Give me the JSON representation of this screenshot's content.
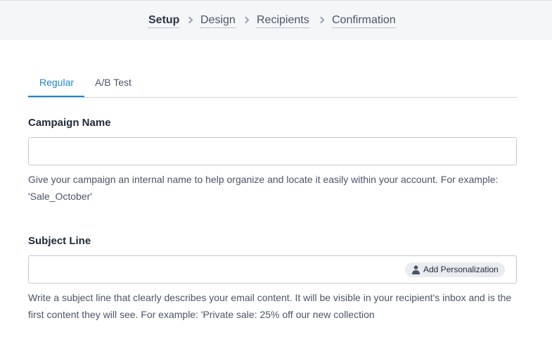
{
  "steps": [
    {
      "label": "Setup",
      "active": true
    },
    {
      "label": "Design",
      "active": false
    },
    {
      "label": "Recipients",
      "active": false
    },
    {
      "label": "Confirmation",
      "active": false
    }
  ],
  "tabs": [
    {
      "label": "Regular",
      "active": true
    },
    {
      "label": "A/B Test",
      "active": false
    }
  ],
  "campaign": {
    "label": "Campaign Name",
    "value": "",
    "help": "Give your campaign an internal name to help organize and locate it easily within your account. For example: 'Sale_October'"
  },
  "subject": {
    "label": "Subject Line",
    "value": "",
    "personalization_label": "Add Personalization",
    "help": "Write a subject line that clearly describes your email content. It will be visible in your recipient's inbox and is the first content they will see. For example: 'Private sale: 25% off our new collection"
  },
  "colors": {
    "accent": "#1f86c9",
    "topbar_bg": "#f5f6f8",
    "text": "#1f2a37"
  }
}
